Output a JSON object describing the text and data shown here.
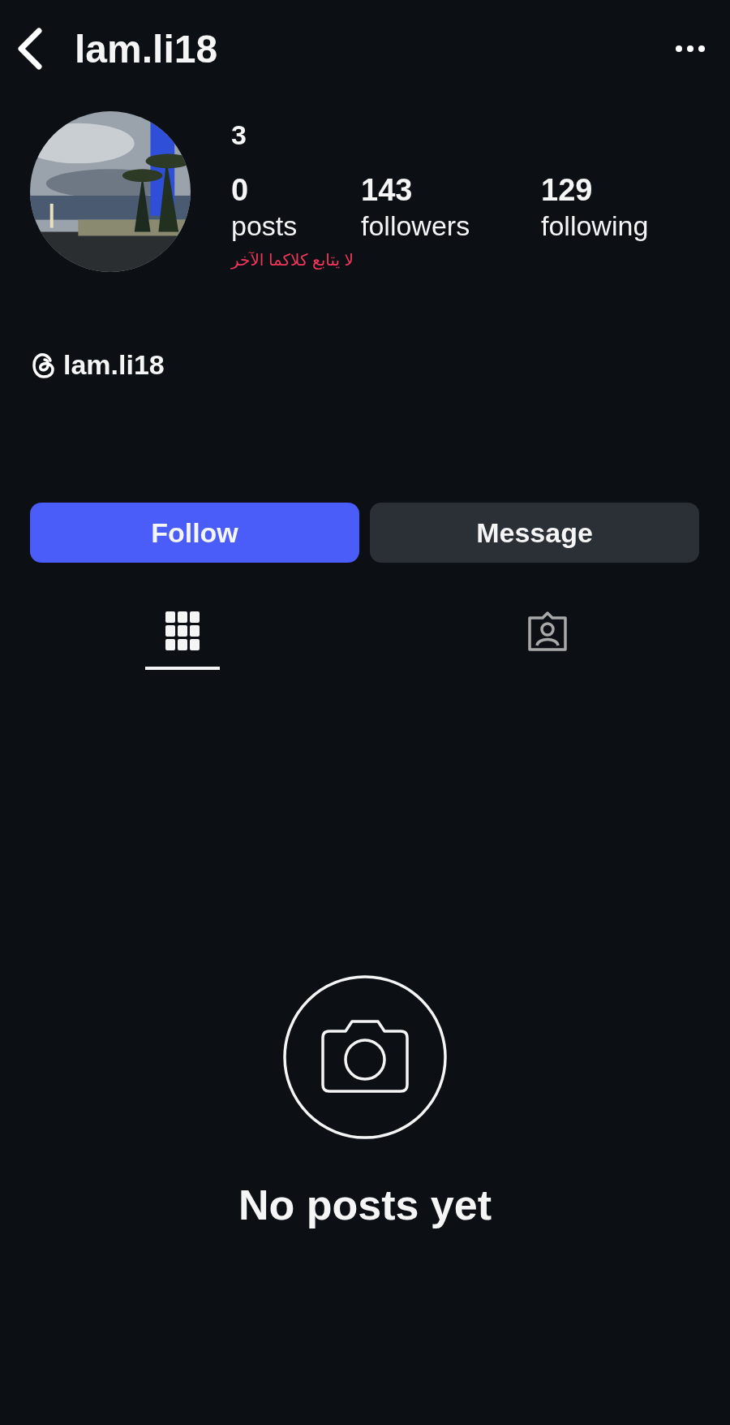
{
  "header": {
    "title": "lam.li18"
  },
  "profile": {
    "highlight": "3",
    "stats": [
      {
        "value": "0",
        "label": "posts"
      },
      {
        "value": "143",
        "label": "followers"
      },
      {
        "value": "129",
        "label": "following"
      }
    ],
    "note": "لا يتابع كلاكما الآخر",
    "threads_handle": "lam.li18"
  },
  "buttons": [
    {
      "label": "Follow",
      "kind": "primary"
    },
    {
      "label": "Message",
      "kind": "secondary"
    }
  ],
  "tabs": [
    {
      "kind": "grid",
      "selected": true
    },
    {
      "kind": "tagged",
      "selected": false
    }
  ],
  "empty_state": {
    "title": "No posts yet"
  }
}
